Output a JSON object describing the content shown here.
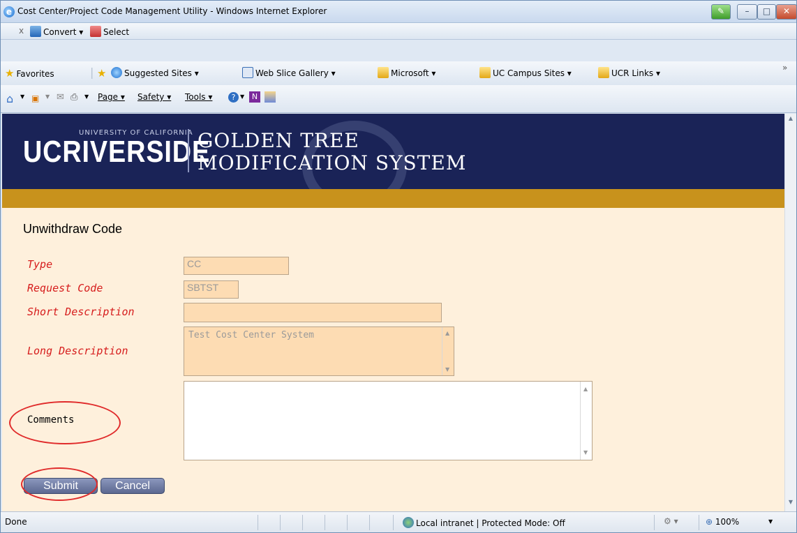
{
  "window": {
    "title": "Cost Center/Project Code Management Utility - Windows Internet Explorer",
    "controls": {
      "green": "✎",
      "minimize": "–",
      "maximize": "□",
      "close": "✕"
    }
  },
  "command_bar": {
    "close": "x",
    "convert": "Convert ▾",
    "select": "Select"
  },
  "favorites_bar": {
    "favorites": "Favorites",
    "items": [
      {
        "label": "Suggested Sites ▾"
      },
      {
        "label": "Web Slice Gallery ▾"
      },
      {
        "label": "Microsoft ▾"
      },
      {
        "label": "UC Campus Sites ▾"
      },
      {
        "label": "UCR Links ▾"
      }
    ],
    "overflow": "»"
  },
  "tools_bar": {
    "page": "Page ▾",
    "safety": "Safety ▾",
    "tools": "Tools ▾"
  },
  "banner": {
    "uc": "UCRIVERSIDE",
    "university": "UNIVERSITY OF CALIFORNIA",
    "line1": "GOLDEN TREE",
    "line2": "MODIFICATION SYSTEM",
    "colors": {
      "navy": "#1a2357",
      "gold": "#c8921c"
    }
  },
  "form": {
    "heading": "Unwithdraw Code",
    "type_label": "Type",
    "type_value": "CC",
    "request_code_label": "Request Code",
    "request_code_value": "SBTST",
    "short_desc_label": "Short Description",
    "short_desc_value": "",
    "long_desc_label": "Long Description",
    "long_desc_value": "Test Cost Center System",
    "comments_label": "Comments",
    "comments_value": "",
    "submit": "Submit",
    "cancel": "Cancel"
  },
  "status_bar": {
    "text": "Done",
    "zone": "Local intranet | Protected Mode: Off",
    "zoom": "100%"
  }
}
